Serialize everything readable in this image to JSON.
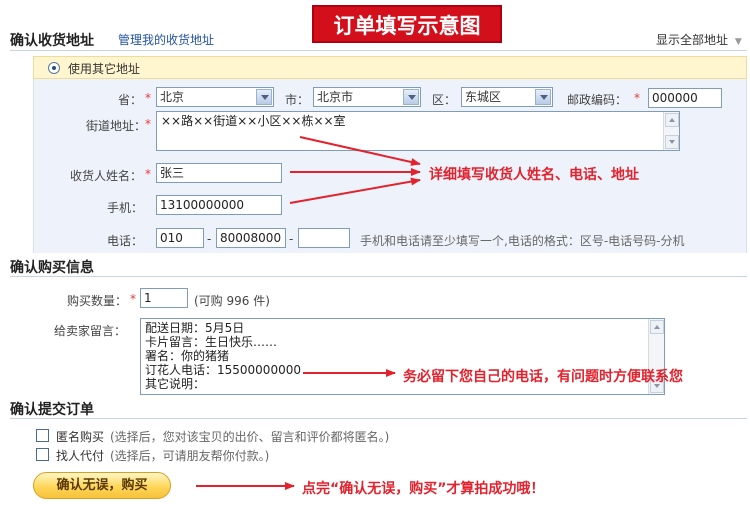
{
  "banner": {
    "title": "订单填写示意图"
  },
  "address_section": {
    "title": "确认收货地址",
    "manage_link": "管理我的收货地址",
    "show_all": "显示全部地址",
    "use_other": "使用其它地址",
    "province_label": "省：",
    "province_value": "北京",
    "city_label": "市：",
    "city_value": "北京市",
    "district_label": "区：",
    "district_value": "东城区",
    "postcode_label": "邮政编码：",
    "postcode_value": "000000",
    "street_label": "街道地址：",
    "street_value": "××路××街道××小区××栋××室",
    "name_label": "收货人姓名：",
    "name_value": "张三",
    "mobile_label": "手机：",
    "mobile_value": "13100000000",
    "phone_label": "电话：",
    "phone_area": "010",
    "phone_number": "80008000",
    "phone_ext": "",
    "phone_sep": "-",
    "phone_hint": "手机和电话请至少填写一个,电话的格式：区号-电话号码-分机"
  },
  "annotations": {
    "address_note": "详细填写收货人姓名、电话、地址",
    "phone_note": "务必留下您自己的电话，有问题时方便联系您",
    "submit_note": "点完“确认无误，购买”才算拍成功哦！"
  },
  "purchase_section": {
    "title": "确认购买信息",
    "qty_label": "购买数量：",
    "qty_value": "1",
    "qty_available": "(可购 996 件)",
    "message_label": "给卖家留言：",
    "message_lines": [
      "配送日期：5月5日",
      "卡片留言：生日快乐……",
      "署名：你的猪猪",
      "订花人电话：15500000000",
      "其它说明："
    ]
  },
  "submit_section": {
    "title": "确认提交订单",
    "anonymous_label": "匿名购买",
    "anonymous_hint": "(选择后，您对该宝贝的出价、留言和评价都将匿名。)",
    "proxy_label": "找人代付",
    "proxy_hint": "(选择后，可请朋友帮你付款。)",
    "button_label": "确认无误，购买"
  },
  "colors": {
    "banner": "#d40f1c",
    "panel": "#eef3fb",
    "note_red": "#e4222d",
    "link": "#2453a6"
  }
}
